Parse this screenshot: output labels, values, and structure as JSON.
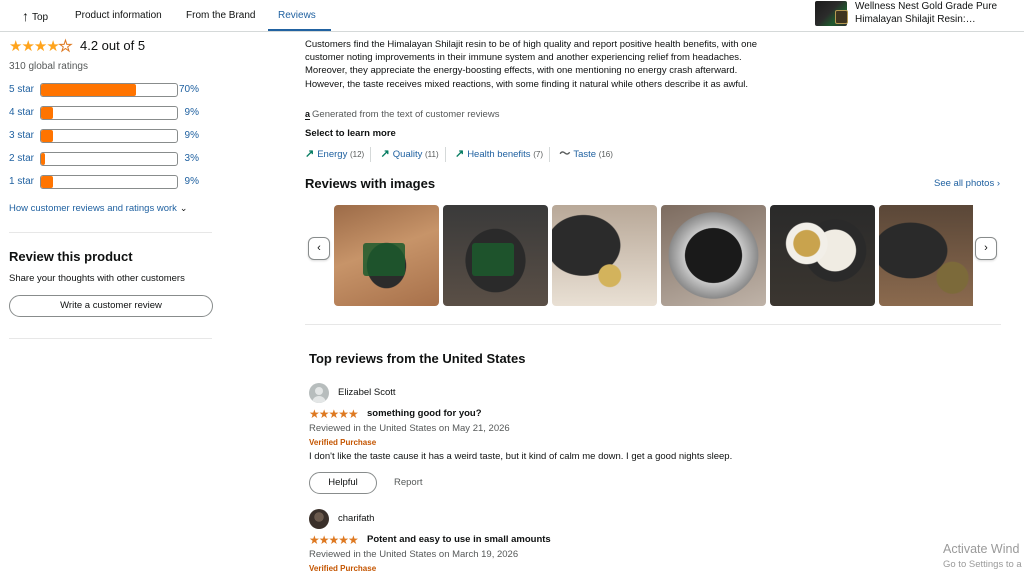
{
  "nav": {
    "top_label": "Top",
    "tabs": [
      "Product information",
      "From the Brand",
      "Reviews"
    ],
    "active_tab": "Reviews"
  },
  "mini_product": {
    "title": "Wellness Nest Gold Grade Pure Himalayan Shilajit Resin:…"
  },
  "ratings": {
    "average_stars": 4.2,
    "average_text": "4.2 out of 5",
    "global_ratings": "310 global ratings",
    "histogram": [
      {
        "label": "5 star",
        "percent": 70,
        "pct_text": "70%"
      },
      {
        "label": "4 star",
        "percent": 9,
        "pct_text": "9%"
      },
      {
        "label": "3 star",
        "percent": 9,
        "pct_text": "9%"
      },
      {
        "label": "2 star",
        "percent": 3,
        "pct_text": "3%"
      },
      {
        "label": "1 star",
        "percent": 9,
        "pct_text": "9%"
      }
    ],
    "how_link": "How customer reviews and ratings work"
  },
  "review_product": {
    "heading": "Review this product",
    "subtext": "Share your thoughts with other customers",
    "button": "Write a customer review"
  },
  "summary": {
    "text": "Customers find the Himalayan Shilajit resin to be of high quality and report positive health benefits, with one customer noting improvements in their immune system and another experiencing relief from headaches. Moreover, they appreciate the energy-boosting effects, with one mentioning no energy crash afterward. However, the taste receives mixed reactions, with some finding it natural while others describe it as awful.",
    "ai_badge": "a",
    "ai_text": "Generated from the text of customer reviews",
    "select_heading": "Select to learn more",
    "aspects": [
      {
        "label": "Energy",
        "count": "(12)",
        "icon": "trend-up-icon"
      },
      {
        "label": "Quality",
        "count": "(11)",
        "icon": "trend-up-icon"
      },
      {
        "label": "Health benefits",
        "count": "(7)",
        "icon": "trend-up-icon"
      },
      {
        "label": "Taste",
        "count": "(16)",
        "icon": "mixed-wave-icon"
      }
    ]
  },
  "reviews_with_images": {
    "heading": "Reviews with images",
    "see_all": "See all photos",
    "image_count": 6
  },
  "top_reviews": {
    "heading": "Top reviews from the United States",
    "items": [
      {
        "name": "Elizabel Scott",
        "stars": 5,
        "title": "something good for you?",
        "date": "Reviewed in the United States on May 21, 2026",
        "verified": "Verified Purchase",
        "body": "I don't like the taste cause it has a weird taste, but it kind of calm me down. I get a good nights sleep.",
        "helpful": "Helpful",
        "report": "Report"
      },
      {
        "name": "charifath",
        "stars": 5,
        "title": "Potent and easy to use in small amounts",
        "date": "Reviewed in the United States on March 19, 2026",
        "verified": "Verified Purchase"
      }
    ]
  },
  "watermark": {
    "line1": "Activate Wind",
    "line2": "Go to Settings to a"
  }
}
